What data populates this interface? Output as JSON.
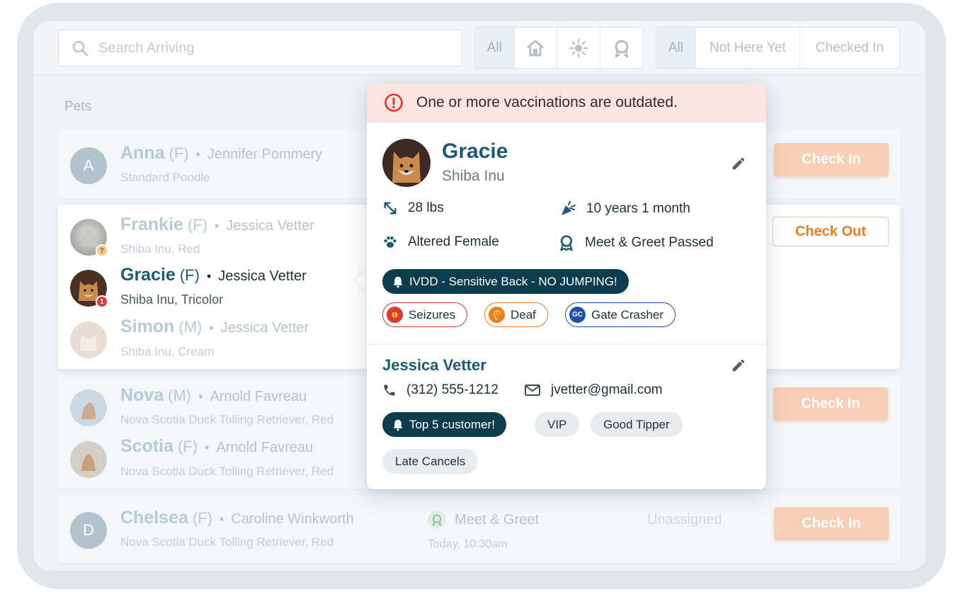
{
  "search": {
    "placeholder": "Search Arriving"
  },
  "filters": {
    "type_all": "All",
    "type_icons": [
      "house-icon",
      "sun-icon",
      "badge-icon"
    ],
    "status_all": "All",
    "status_not_here": "Not Here Yet",
    "status_checked_in": "Checked In"
  },
  "list": {
    "heading": "Pets",
    "cards": [
      {
        "pets": [
          {
            "initial": "A",
            "name": "Anna",
            "sex": "(F)",
            "owner": "Jennifer Pommery",
            "breed": "Standard Poodle"
          }
        ],
        "action": "Check In"
      },
      {
        "pets": [
          {
            "name": "Frankie",
            "sex": "(F)",
            "owner": "Jessica Vetter",
            "breed": "Shiba Inu, Red",
            "badge": "?"
          },
          {
            "name": "Gracie",
            "sex": "(F)",
            "owner": "Jessica Vetter",
            "breed": "Shiba Inu, Tricolor",
            "badge": "1"
          },
          {
            "name": "Simon",
            "sex": "(M)",
            "owner": "Jessica Vetter",
            "breed": "Shiba Inu, Cream"
          }
        ],
        "action": "Check Out"
      },
      {
        "pets": [
          {
            "name": "Nova",
            "sex": "(M)",
            "owner": "Arnold Favreau",
            "breed": "Nova Scotia Duck Tolling Retriever, Red"
          },
          {
            "name": "Scotia",
            "sex": "(F)",
            "owner": "Arnold Favreau",
            "breed": "Nova Scotia Duck Tolling Retriever, Red"
          }
        ],
        "action": "Check In"
      },
      {
        "pets": [
          {
            "initial": "D",
            "name": "Chelsea",
            "sex": "(F)",
            "owner": "Caroline Winkworth",
            "breed": "Nova Scotia Duck Tolling Retriever, Red"
          }
        ],
        "service": "Meet & Greet",
        "service_time": "Today, 10:30am",
        "assignee": "Unassigned",
        "action": "Check In"
      }
    ]
  },
  "popover": {
    "alert": "One or more vaccinations are outdated.",
    "pet": {
      "name": "Gracie",
      "breed": "Shiba Inu",
      "weight": "28 lbs",
      "age": "10 years 1 month",
      "status": "Altered Female",
      "evaluation": "Meet & Greet Passed",
      "alert_tag": "IVDD - Sensitive Back - NO JUMPING!",
      "tags": [
        {
          "label": "Seizures",
          "color": "#d93a32"
        },
        {
          "label": "Deaf",
          "color": "#ef7d1d"
        },
        {
          "label": "Gate Crasher",
          "icon_text": "GC",
          "color": "#1f4fa8"
        }
      ]
    },
    "owner": {
      "name": "Jessica Vetter",
      "phone": "(312) 555-1212",
      "email": "jvetter@gmail.com",
      "alert_tag": "Top 5 customer!",
      "tags": [
        "VIP",
        "Good Tipper",
        "Late Cancels"
      ]
    }
  },
  "colors": {
    "accent_teal": "#1c5a78",
    "dark_tag": "#0c3d4f",
    "orange": "#f27b1f",
    "alert_bg": "#fbe3e1",
    "alert_icon": "#e2332b"
  }
}
